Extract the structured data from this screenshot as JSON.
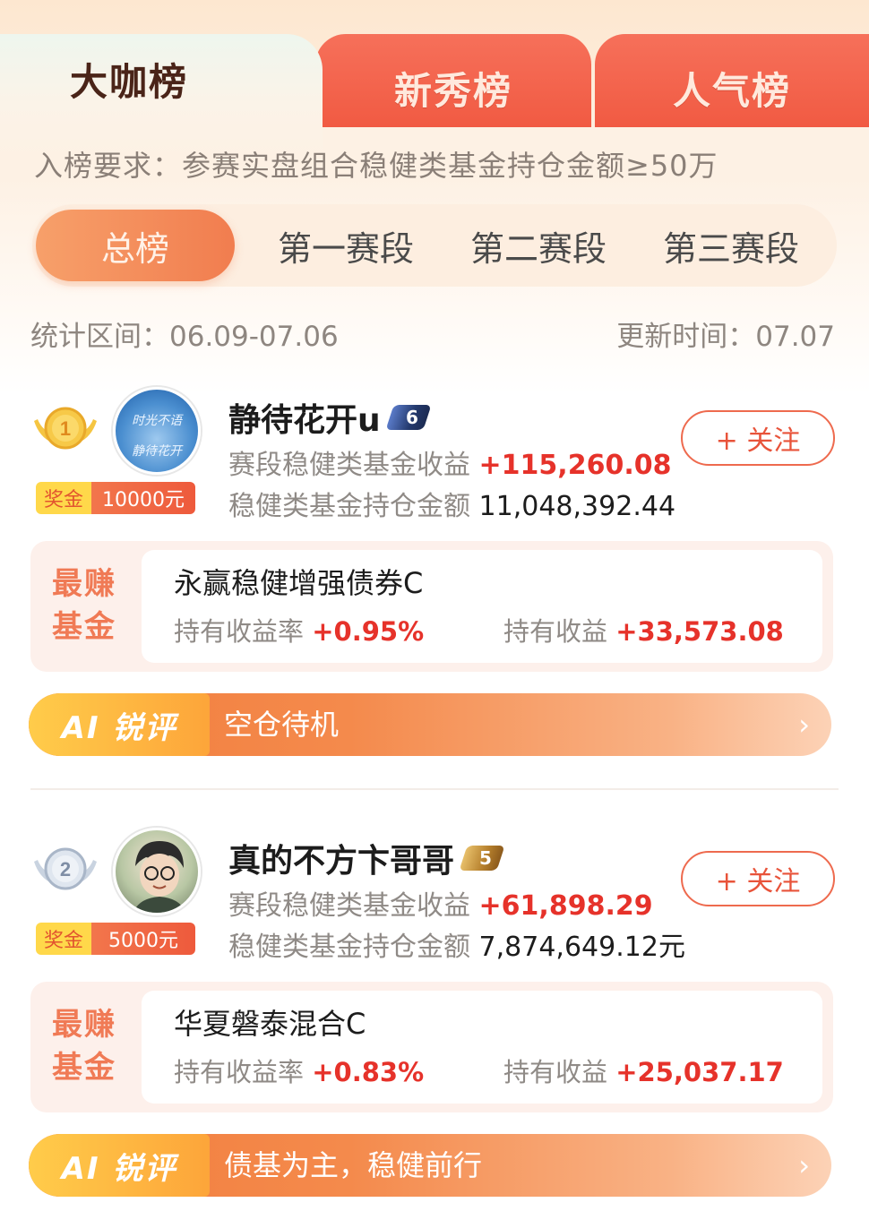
{
  "tabs": [
    {
      "label": "大咖榜",
      "active": true
    },
    {
      "label": "新秀榜",
      "active": false
    },
    {
      "label": "人气榜",
      "active": false
    }
  ],
  "requirement": "入榜要求：参赛实盘组合稳健类基金持仓金额≥50万",
  "segments": [
    "总榜",
    "第一赛段",
    "第二赛段",
    "第三赛段"
  ],
  "period": {
    "label": "统计区间：",
    "value": "06.09-07.06"
  },
  "update": {
    "label": "更新时间：",
    "value": "07.07"
  },
  "labels": {
    "prize": "奖金",
    "stage_return": "赛段稳健类基金收益",
    "holding_amount": "稳健类基金持仓金额",
    "follow": "+ 关注",
    "best_fund_line1": "最赚",
    "best_fund_line2": "基金",
    "hold_rate": "持有收益率",
    "hold_return": "持有收益",
    "ai_tag": "AI 锐评",
    "arrow": "›"
  },
  "entries": [
    {
      "rank": "1",
      "avatar_text": [
        "时光不语",
        "静待花开"
      ],
      "prize": "10000元",
      "name": "静待花开u",
      "level": "6",
      "stage_return": "+115,260.08",
      "holding_amount": "11,048,392.44",
      "fund": {
        "name": "永赢稳健增强债券C",
        "rate": "+0.95%",
        "return": "+33,573.08"
      },
      "ai_comment": "空仓待机"
    },
    {
      "rank": "2",
      "prize": "5000元",
      "name": "真的不方卞哥哥",
      "level": "5",
      "stage_return": "+61,898.29",
      "holding_amount": "7,874,649.12元",
      "fund": {
        "name": "华夏磐泰混合C",
        "rate": "+0.83%",
        "return": "+25,037.17"
      },
      "ai_comment": "债基为主，稳健前行"
    }
  ],
  "colors": {
    "accent": "#f0573f",
    "red": "#e6322a",
    "gold": "#ffd84a"
  }
}
